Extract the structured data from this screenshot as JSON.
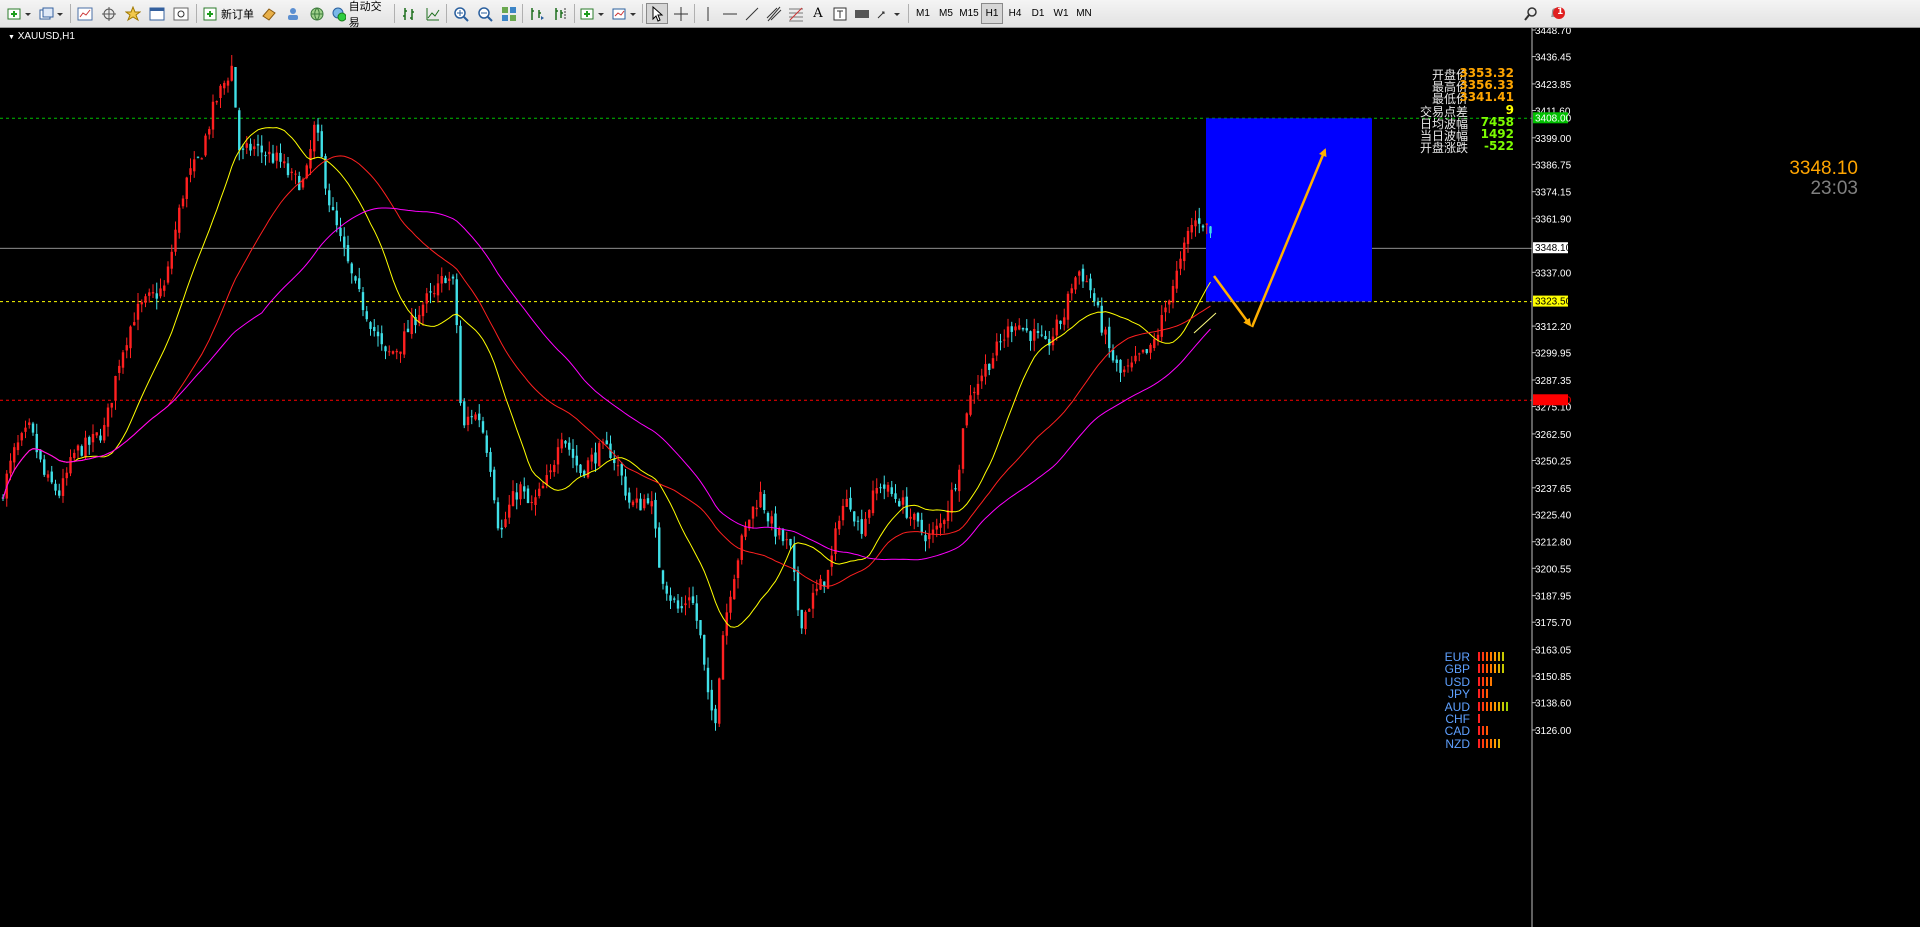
{
  "toolbar": {
    "new_order_label": "新订单",
    "auto_trade_label": "自动交易",
    "timeframes": [
      "M1",
      "M5",
      "M15",
      "H1",
      "H4",
      "D1",
      "W1",
      "MN"
    ],
    "active_timeframe": "H1",
    "notification_count": "1"
  },
  "chart": {
    "symbol_label": "XAUUSD,H1",
    "info_panel": [
      {
        "label": "开盘价",
        "value": "3353.32",
        "color": "#ffa500"
      },
      {
        "label": "最高价",
        "value": "3356.33",
        "color": "#ffa500"
      },
      {
        "label": "最低价",
        "value": "3341.41",
        "color": "#ffa500"
      },
      {
        "label": "交易点差",
        "value": "9",
        "color": "#ffff00"
      },
      {
        "label": "日均波幅",
        "value": "7458",
        "color": "#7cfc00"
      },
      {
        "label": "当日波幅",
        "value": "1492",
        "color": "#7cfc00"
      },
      {
        "label": "开盘涨跌",
        "value": "-522",
        "color": "#7cfc00"
      }
    ],
    "current_price": "3348.10",
    "countdown": "23:03",
    "axis_labels": [
      "3448.70",
      "3436.45",
      "3423.85",
      "3411.60",
      "3399.00",
      "3386.75",
      "3374.15",
      "3361.90",
      "3337.00",
      "3312.20",
      "3299.95",
      "3287.35",
      "3275.10",
      "3262.50",
      "3250.25",
      "3237.65",
      "3225.40",
      "3212.80",
      "3200.55",
      "3187.95",
      "3175.70",
      "3163.05",
      "3150.85",
      "3138.60",
      "3126.00"
    ],
    "price_tags": [
      {
        "text": "3408.00",
        "bg": "#00c000",
        "fg": "#ffffff"
      },
      {
        "text": "3348.10",
        "bg": "#ffffff",
        "fg": "#000000"
      },
      {
        "text": "3323.50",
        "bg": "#ffff00",
        "fg": "#000000"
      },
      {
        "text": "3278.00",
        "bg": "#ff0000",
        "fg": "#ff0000"
      }
    ],
    "colors": {
      "bull_candle": "#ff2020",
      "bear_candle": "#40e0e8",
      "ma_fast": "#ffff00",
      "ma_mid": "#ff2020",
      "ma_slow": "#ff00ff",
      "target_box": "#0000ff",
      "arrow": "#ffb000"
    },
    "currency_strength": [
      {
        "name": "EUR",
        "level": 7
      },
      {
        "name": "GBP",
        "level": 7
      },
      {
        "name": "USD",
        "level": 4
      },
      {
        "name": "JPY",
        "level": 3
      },
      {
        "name": "AUD",
        "level": 8
      },
      {
        "name": "CHF",
        "level": 1
      },
      {
        "name": "CAD",
        "level": 3
      },
      {
        "name": "NZD",
        "level": 6
      }
    ]
  }
}
